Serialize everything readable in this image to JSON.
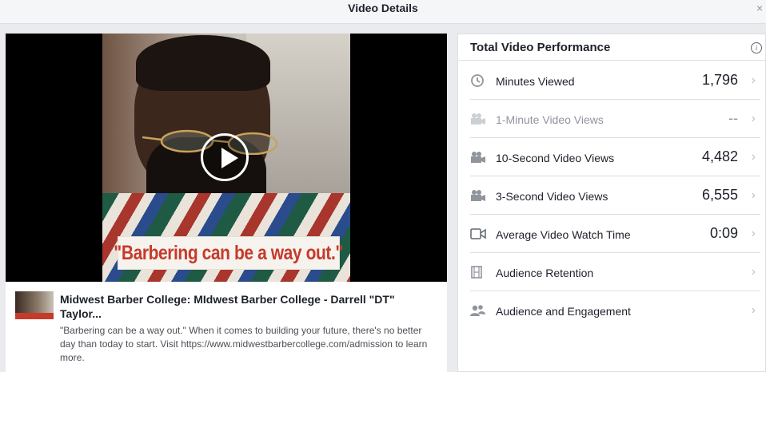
{
  "window": {
    "title": "Video Details",
    "close_label": "×"
  },
  "video": {
    "caption": "\"Barbering can be a way out.\"",
    "post_title": "Midwest Barber College: MIdwest Barber College - Darrell \"DT\" Taylor...",
    "post_description": "\"Barbering can be a way out.\" When it comes to building your future, there's no better day than today to start. Visit https://www.midwestbarbercollege.com/admission to learn more."
  },
  "performance": {
    "title": "Total Video Performance",
    "info_icon": "i",
    "metrics": [
      {
        "icon": "clock-icon",
        "label": "Minutes Viewed",
        "value": "1,796",
        "dim": false
      },
      {
        "icon": "video-camera-icon",
        "label": "1-Minute Video Views",
        "value": "--",
        "dim": true
      },
      {
        "icon": "video-camera-icon",
        "label": "10-Second Video Views",
        "value": "4,482",
        "dim": false
      },
      {
        "icon": "video-camera-icon",
        "label": "3-Second Video Views",
        "value": "6,555",
        "dim": false
      },
      {
        "icon": "video-outline-icon",
        "label": "Average Video Watch Time",
        "value": "0:09",
        "dim": false
      },
      {
        "icon": "film-icon",
        "label": "Audience Retention",
        "value": "",
        "dim": false
      },
      {
        "icon": "people-icon",
        "label": "Audience and Engagement",
        "value": "",
        "dim": false
      }
    ]
  }
}
